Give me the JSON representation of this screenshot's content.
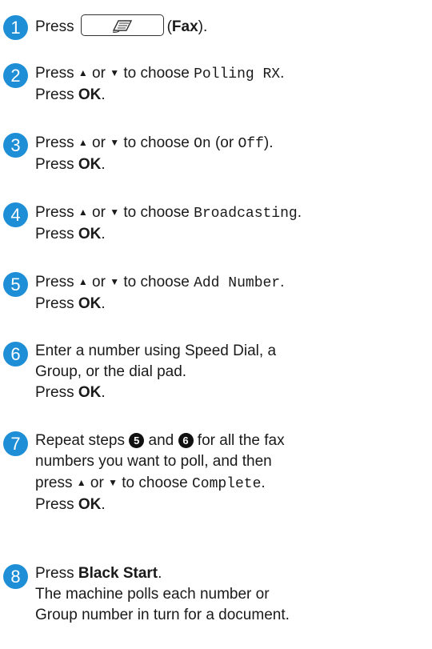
{
  "steps": [
    {
      "number": "1",
      "press": "Press",
      "key_open": "(",
      "key_label": "Fax",
      "key_close": ")."
    },
    {
      "number": "2",
      "line1_pre": "Press",
      "up_arrow": "▲",
      "or": "or",
      "down_arrow": "▼",
      "to_choose": "to choose",
      "option": "Polling RX",
      "period": ".",
      "press": "Press",
      "ok": "OK",
      "ok_period": "."
    },
    {
      "number": "3",
      "line1_pre": "Press",
      "up_arrow": "▲",
      "or": "or",
      "down_arrow": "▼",
      "to_choose": "to choose",
      "option": "On",
      "paren_open": "(or",
      "option_alt": "Off",
      "paren_close": ").",
      "press": "Press",
      "ok": "OK",
      "ok_period": "."
    },
    {
      "number": "4",
      "line1_pre": "Press",
      "up_arrow": "▲",
      "or": "or",
      "down_arrow": "▼",
      "to_choose": "to choose",
      "option": "Broadcasting",
      "period": ".",
      "press": "Press",
      "ok": "OK",
      "ok_period": "."
    },
    {
      "number": "5",
      "line1_pre": "Press",
      "up_arrow": "▲",
      "or": "or",
      "down_arrow": "▼",
      "to_choose": "to choose",
      "option": "Add Number",
      "period": ".",
      "press": "Press",
      "ok": "OK",
      "ok_period": "."
    },
    {
      "number": "6",
      "line1": "Enter a number using Speed Dial, a",
      "line2": "Group, or the dial pad.",
      "press": "Press",
      "ok": "OK",
      "ok_period": "."
    },
    {
      "number": "7",
      "line1_pre": "Repeat steps",
      "ref_a": "5",
      "and": "and",
      "ref_b": "6",
      "line1_post": "for all the fax",
      "line2": "numbers you want to poll, and then",
      "line3_pre": "press",
      "up_arrow": "▲",
      "or": "or",
      "down_arrow": "▼",
      "to_choose": "to choose",
      "option": "Complete",
      "period": ".",
      "press": "Press",
      "ok": "OK",
      "ok_period": "."
    },
    {
      "number": "8",
      "press": "Press",
      "action": "Black Start",
      "period": ".",
      "line2": "The machine polls each number or",
      "line3": "Group number in turn for a document."
    }
  ]
}
